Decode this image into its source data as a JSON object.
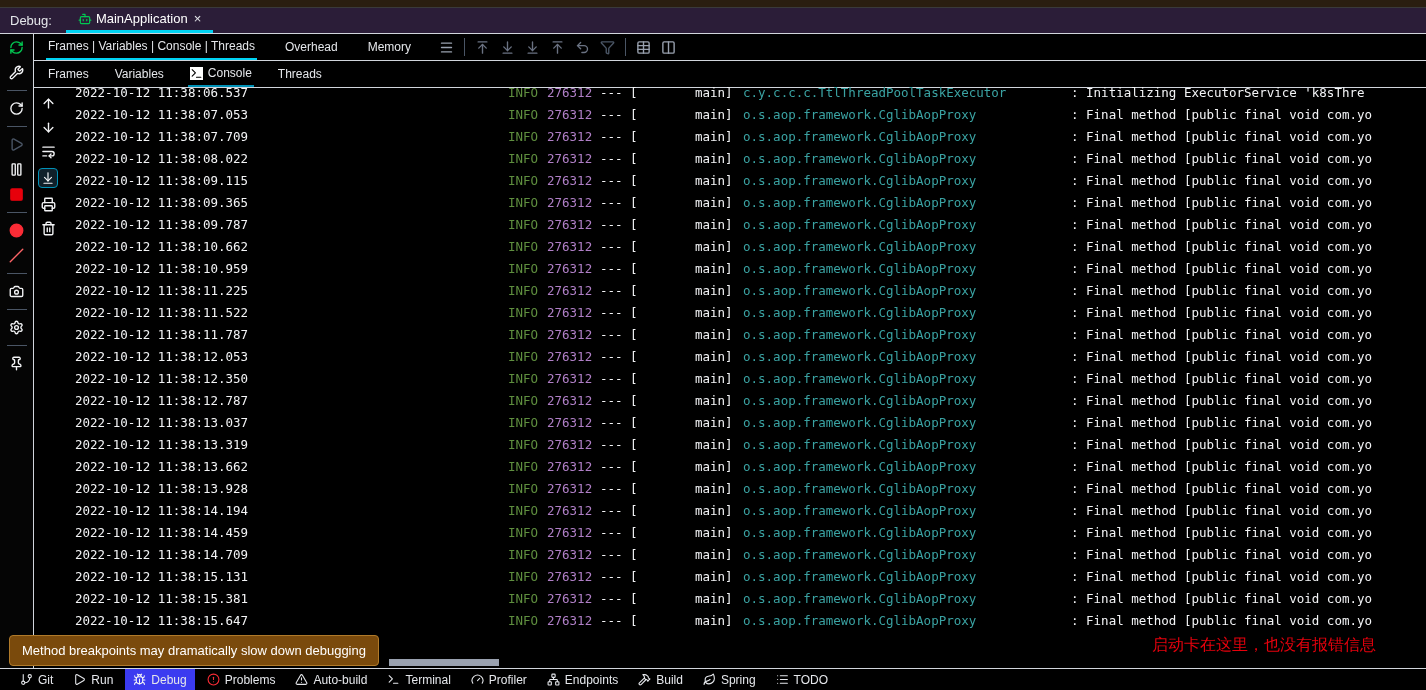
{
  "debug_bar": {
    "label": "Debug:",
    "tabs": [
      {
        "label": "MainApplication",
        "close": "×",
        "selected": true
      }
    ]
  },
  "tabs": [
    {
      "label": "Frames | Variables | Console | Threads",
      "selected": true
    },
    {
      "label": "Overhead",
      "selected": false
    },
    {
      "label": "Memory",
      "selected": false
    }
  ],
  "subtabs": [
    {
      "label": "Frames",
      "selected": false,
      "kind": "text"
    },
    {
      "label": "Variables",
      "selected": false,
      "kind": "text"
    },
    {
      "label": "Console",
      "selected": true,
      "kind": "console"
    },
    {
      "label": "Threads",
      "selected": false,
      "kind": "text"
    }
  ],
  "debug_toolbar": {
    "resume_disabled": true
  },
  "console_toolbar": {
    "scroll_to_end": true
  },
  "log": [
    {
      "time": "2022-10-12 11:38:06.537",
      "level": "INFO",
      "pid": "276312",
      "sep": "--- [",
      "thread": "main]",
      "logger": "c.y.c.c.c.TtlThreadPoolTaskExecutor",
      "message": ": Initializing ExecutorService  'k8sThre"
    },
    {
      "time": "2022-10-12 11:38:07.053",
      "level": "INFO",
      "pid": "276312",
      "sep": "--- [",
      "thread": "main]",
      "logger": "o.s.aop.framework.CglibAopProxy",
      "message": ": Final method [public final void com.yo"
    },
    {
      "time": "2022-10-12 11:38:07.709",
      "level": "INFO",
      "pid": "276312",
      "sep": "--- [",
      "thread": "main]",
      "logger": "o.s.aop.framework.CglibAopProxy",
      "message": ": Final method [public final void com.yo"
    },
    {
      "time": "2022-10-12 11:38:08.022",
      "level": "INFO",
      "pid": "276312",
      "sep": "--- [",
      "thread": "main]",
      "logger": "o.s.aop.framework.CglibAopProxy",
      "message": ": Final method [public final void com.yo"
    },
    {
      "time": "2022-10-12 11:38:09.115",
      "level": "INFO",
      "pid": "276312",
      "sep": "--- [",
      "thread": "main]",
      "logger": "o.s.aop.framework.CglibAopProxy",
      "message": ": Final method [public final void com.yo"
    },
    {
      "time": "2022-10-12 11:38:09.365",
      "level": "INFO",
      "pid": "276312",
      "sep": "--- [",
      "thread": "main]",
      "logger": "o.s.aop.framework.CglibAopProxy",
      "message": ": Final method [public final void com.yo"
    },
    {
      "time": "2022-10-12 11:38:09.787",
      "level": "INFO",
      "pid": "276312",
      "sep": "--- [",
      "thread": "main]",
      "logger": "o.s.aop.framework.CglibAopProxy",
      "message": ": Final method [public final void com.yo"
    },
    {
      "time": "2022-10-12 11:38:10.662",
      "level": "INFO",
      "pid": "276312",
      "sep": "--- [",
      "thread": "main]",
      "logger": "o.s.aop.framework.CglibAopProxy",
      "message": ": Final method [public final void com.yo"
    },
    {
      "time": "2022-10-12 11:38:10.959",
      "level": "INFO",
      "pid": "276312",
      "sep": "--- [",
      "thread": "main]",
      "logger": "o.s.aop.framework.CglibAopProxy",
      "message": ": Final method [public final void com.yo"
    },
    {
      "time": "2022-10-12 11:38:11.225",
      "level": "INFO",
      "pid": "276312",
      "sep": "--- [",
      "thread": "main]",
      "logger": "o.s.aop.framework.CglibAopProxy",
      "message": ": Final method [public final void com.yo"
    },
    {
      "time": "2022-10-12 11:38:11.522",
      "level": "INFO",
      "pid": "276312",
      "sep": "--- [",
      "thread": "main]",
      "logger": "o.s.aop.framework.CglibAopProxy",
      "message": ": Final method [public final void com.yo"
    },
    {
      "time": "2022-10-12 11:38:11.787",
      "level": "INFO",
      "pid": "276312",
      "sep": "--- [",
      "thread": "main]",
      "logger": "o.s.aop.framework.CglibAopProxy",
      "message": ": Final method [public final void com.yo"
    },
    {
      "time": "2022-10-12 11:38:12.053",
      "level": "INFO",
      "pid": "276312",
      "sep": "--- [",
      "thread": "main]",
      "logger": "o.s.aop.framework.CglibAopProxy",
      "message": ": Final method [public final void com.yo"
    },
    {
      "time": "2022-10-12 11:38:12.350",
      "level": "INFO",
      "pid": "276312",
      "sep": "--- [",
      "thread": "main]",
      "logger": "o.s.aop.framework.CglibAopProxy",
      "message": ": Final method [public final void com.yo"
    },
    {
      "time": "2022-10-12 11:38:12.787",
      "level": "INFO",
      "pid": "276312",
      "sep": "--- [",
      "thread": "main]",
      "logger": "o.s.aop.framework.CglibAopProxy",
      "message": ": Final method [public final void com.yo"
    },
    {
      "time": "2022-10-12 11:38:13.037",
      "level": "INFO",
      "pid": "276312",
      "sep": "--- [",
      "thread": "main]",
      "logger": "o.s.aop.framework.CglibAopProxy",
      "message": ": Final method [public final void com.yo"
    },
    {
      "time": "2022-10-12 11:38:13.319",
      "level": "INFO",
      "pid": "276312",
      "sep": "--- [",
      "thread": "main]",
      "logger": "o.s.aop.framework.CglibAopProxy",
      "message": ": Final method [public final void com.yo"
    },
    {
      "time": "2022-10-12 11:38:13.662",
      "level": "INFO",
      "pid": "276312",
      "sep": "--- [",
      "thread": "main]",
      "logger": "o.s.aop.framework.CglibAopProxy",
      "message": ": Final method [public final void com.yo"
    },
    {
      "time": "2022-10-12 11:38:13.928",
      "level": "INFO",
      "pid": "276312",
      "sep": "--- [",
      "thread": "main]",
      "logger": "o.s.aop.framework.CglibAopProxy",
      "message": ": Final method [public final void com.yo"
    },
    {
      "time": "2022-10-12 11:38:14.194",
      "level": "INFO",
      "pid": "276312",
      "sep": "--- [",
      "thread": "main]",
      "logger": "o.s.aop.framework.CglibAopProxy",
      "message": ": Final method [public final void com.yo"
    },
    {
      "time": "2022-10-12 11:38:14.459",
      "level": "INFO",
      "pid": "276312",
      "sep": "--- [",
      "thread": "main]",
      "logger": "o.s.aop.framework.CglibAopProxy",
      "message": ": Final method [public final void com.yo"
    },
    {
      "time": "2022-10-12 11:38:14.709",
      "level": "INFO",
      "pid": "276312",
      "sep": "--- [",
      "thread": "main]",
      "logger": "o.s.aop.framework.CglibAopProxy",
      "message": ": Final method [public final void com.yo"
    },
    {
      "time": "2022-10-12 11:38:15.131",
      "level": "INFO",
      "pid": "276312",
      "sep": "--- [",
      "thread": "main]",
      "logger": "o.s.aop.framework.CglibAopProxy",
      "message": ": Final method [public final void com.yo"
    },
    {
      "time": "2022-10-12 11:38:15.381",
      "level": "INFO",
      "pid": "276312",
      "sep": "--- [",
      "thread": "main]",
      "logger": "o.s.aop.framework.CglibAopProxy",
      "message": ": Final method [public final void com.yo"
    },
    {
      "time": "2022-10-12 11:38:15.647",
      "level": "INFO",
      "pid": "276312",
      "sep": "--- [",
      "thread": "main]",
      "logger": "o.s.aop.framework.CglibAopProxy",
      "message": ": Final method [public final void com.yo"
    }
  ],
  "annotation": "启动卡在这里，也没有报错信息",
  "tooltip": "Method breakpoints may dramatically slow down debugging",
  "bottom_bar": [
    {
      "label": "Git",
      "kind": "git",
      "selected": false
    },
    {
      "label": "Run",
      "kind": "run",
      "selected": false
    },
    {
      "label": "Debug",
      "kind": "debug",
      "selected": true
    },
    {
      "label": "Problems",
      "kind": "problems",
      "selected": false
    },
    {
      "label": "Auto-build",
      "kind": "warning",
      "selected": false
    },
    {
      "label": "Terminal",
      "kind": "terminal",
      "selected": false
    },
    {
      "label": "Profiler",
      "kind": "profiler",
      "selected": false
    },
    {
      "label": "Endpoints",
      "kind": "endpoints",
      "selected": false
    },
    {
      "label": "Build",
      "kind": "build",
      "selected": false
    },
    {
      "label": "Spring",
      "kind": "spring",
      "selected": false
    },
    {
      "label": "TODO",
      "kind": "todo",
      "selected": false
    }
  ]
}
